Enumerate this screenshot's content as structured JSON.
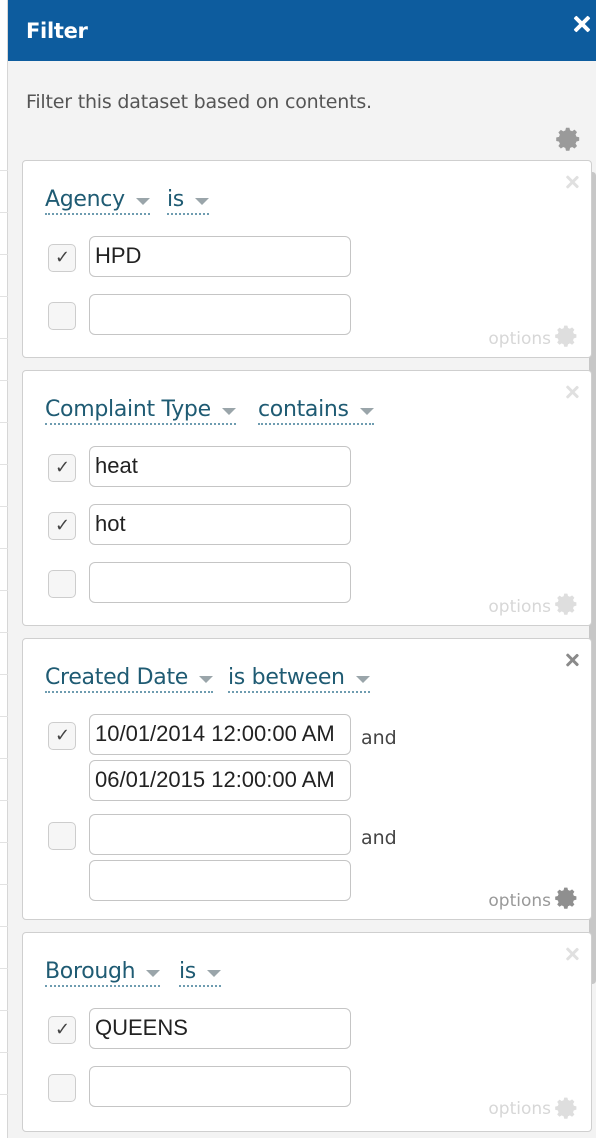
{
  "dialog": {
    "title": "Filter",
    "description": "Filter this dataset based on contents."
  },
  "filters": [
    {
      "column": "Agency",
      "operator": "is",
      "rows": [
        {
          "checked": true,
          "value": "HPD"
        },
        {
          "checked": false,
          "value": ""
        }
      ],
      "options_label": "options"
    },
    {
      "column": "Complaint Type",
      "operator": "contains",
      "rows": [
        {
          "checked": true,
          "value": "heat"
        },
        {
          "checked": true,
          "value": "hot"
        },
        {
          "checked": false,
          "value": ""
        }
      ],
      "options_label": "options"
    },
    {
      "column": "Created Date",
      "operator": "is between",
      "and_label": "and",
      "ranges": [
        {
          "checked": true,
          "from": "10/01/2014 12:00:00 AM",
          "to": "06/01/2015 12:00:00 AM"
        },
        {
          "checked": false,
          "from": "",
          "to": ""
        }
      ],
      "options_label": "options"
    },
    {
      "column": "Borough",
      "operator": "is",
      "rows": [
        {
          "checked": true,
          "value": "QUEENS"
        },
        {
          "checked": false,
          "value": ""
        }
      ],
      "options_label": "options"
    }
  ],
  "icons": {
    "close": "close-icon",
    "settings": "gear-icon",
    "check": "checkmark-icon",
    "dropdown": "caret-down-icon"
  },
  "colors": {
    "header_bg": "#0d5c9e",
    "link_text": "#1f5b73"
  }
}
